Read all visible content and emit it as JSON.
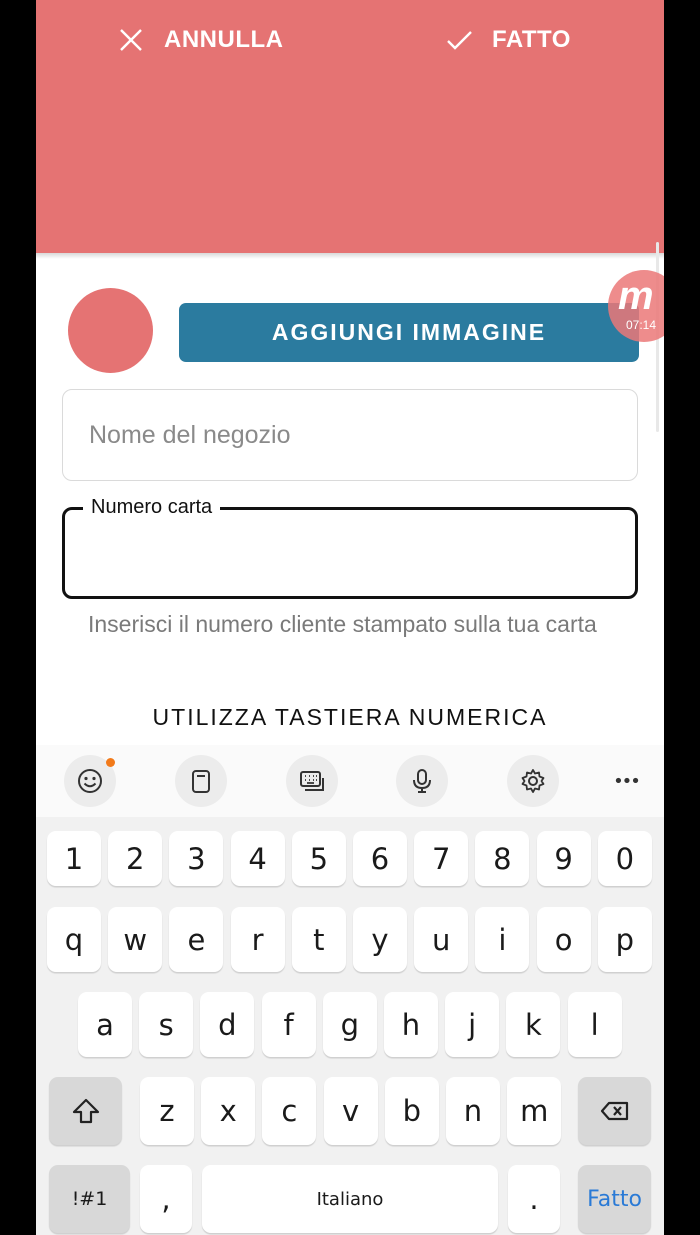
{
  "header": {
    "cancel_label": "ANNULLA",
    "done_label": "FATTO",
    "color": "#e57373"
  },
  "logo": {
    "add_image_label": "AGGIUNGI IMMAGINE",
    "button_color": "#2b7b9f"
  },
  "overlay": {
    "letter": "m",
    "time": "07:14"
  },
  "form": {
    "shop_name_placeholder": "Nome del negozio",
    "shop_name_value": "",
    "card_number_label": "Numero carta",
    "card_number_value": "",
    "card_number_helper": "Inserisci il numero cliente stampato sulla tua carta",
    "numeric_keyboard_label": "UTILIZZA TASTIERA NUMERICA"
  },
  "keyboard": {
    "toolbar": [
      "emoji-icon",
      "clipboard-icon",
      "keyboard-mode-icon",
      "microphone-icon",
      "settings-icon",
      "more-icon"
    ],
    "more_label": "•••",
    "number_row": [
      "1",
      "2",
      "3",
      "4",
      "5",
      "6",
      "7",
      "8",
      "9",
      "0"
    ],
    "row1": [
      "q",
      "w",
      "e",
      "r",
      "t",
      "y",
      "u",
      "i",
      "o",
      "p"
    ],
    "row2": [
      "a",
      "s",
      "d",
      "f",
      "g",
      "h",
      "j",
      "k",
      "l"
    ],
    "row3": [
      "z",
      "x",
      "c",
      "v",
      "b",
      "n",
      "m"
    ],
    "symbols_label": "!#1",
    "comma": ",",
    "space_label": "Italiano",
    "period": ".",
    "action_label": "Fatto",
    "action_color": "#2a7ad6"
  }
}
